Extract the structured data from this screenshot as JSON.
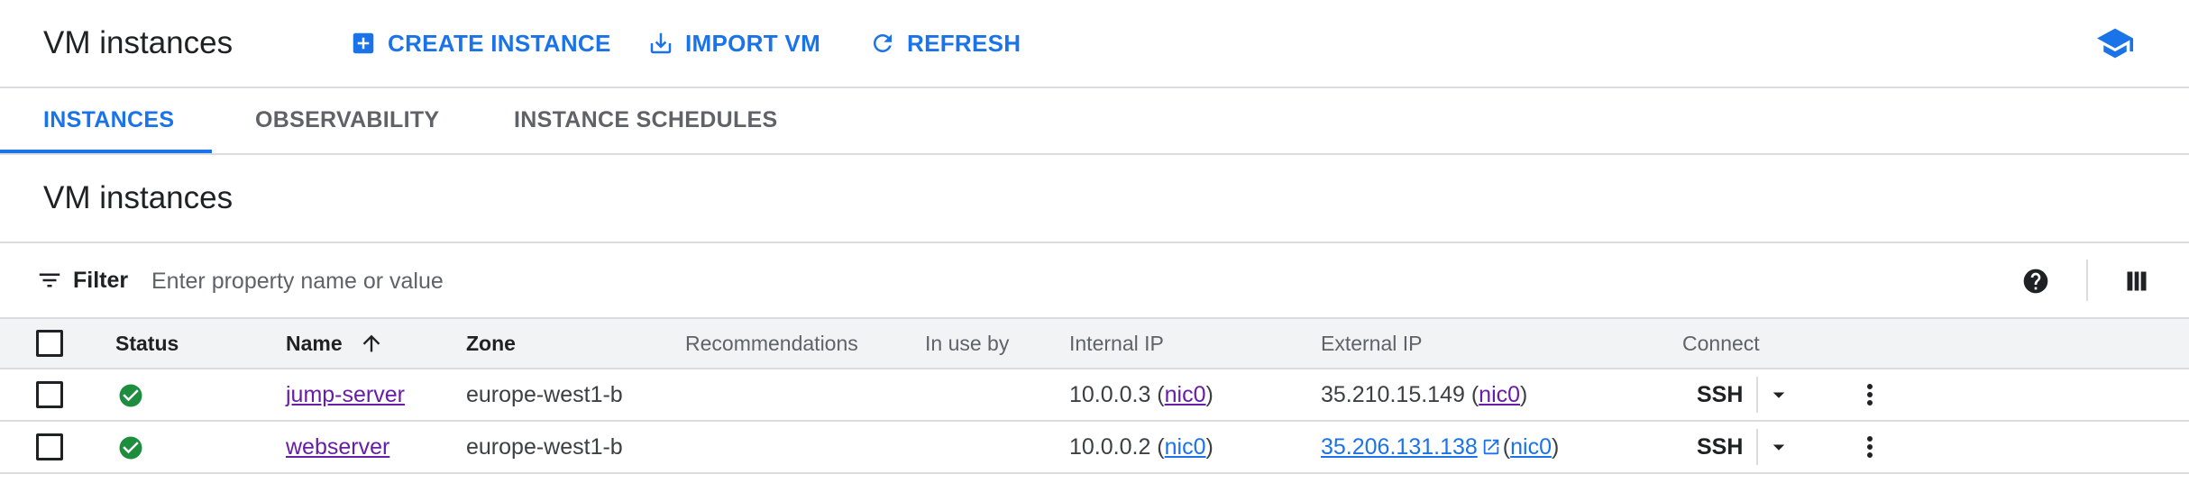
{
  "header": {
    "title": "VM instances",
    "create_label": "CREATE INSTANCE",
    "import_label": "IMPORT VM",
    "refresh_label": "REFRESH",
    "learn_icon": "school-icon"
  },
  "tabs": [
    {
      "label": "INSTANCES",
      "active": true
    },
    {
      "label": "OBSERVABILITY",
      "active": false
    },
    {
      "label": "INSTANCE SCHEDULES",
      "active": false
    }
  ],
  "section": {
    "title": "VM instances"
  },
  "filter": {
    "label": "Filter",
    "placeholder": "Enter property name or value",
    "value": ""
  },
  "table": {
    "columns": {
      "status": "Status",
      "name": "Name",
      "zone": "Zone",
      "recommendations": "Recommendations",
      "in_use_by": "In use by",
      "internal_ip": "Internal IP",
      "external_ip": "External IP",
      "connect": "Connect"
    },
    "sort": {
      "column": "Name",
      "direction": "ascending"
    },
    "rows": [
      {
        "status": "running",
        "name": "jump-server",
        "zone": "europe-west1-b",
        "recommendations": "",
        "in_use_by": "",
        "internal_ip": "10.0.0.3",
        "internal_nic": "nic0",
        "external_ip": "35.210.15.149",
        "external_ip_is_link": false,
        "external_nic": "nic0",
        "connect": "SSH"
      },
      {
        "status": "running",
        "name": "webserver",
        "zone": "europe-west1-b",
        "recommendations": "",
        "in_use_by": "",
        "internal_ip": "10.0.0.2",
        "internal_nic": "nic0",
        "external_ip": "35.206.131.138",
        "external_ip_is_link": true,
        "external_nic": "nic0",
        "connect": "SSH"
      }
    ]
  },
  "colors": {
    "accent": "#1a73e8",
    "visited_link": "#681da8",
    "status_ok": "#1e8e3e",
    "border": "#dadce0",
    "header_bg": "#f1f3f4"
  }
}
